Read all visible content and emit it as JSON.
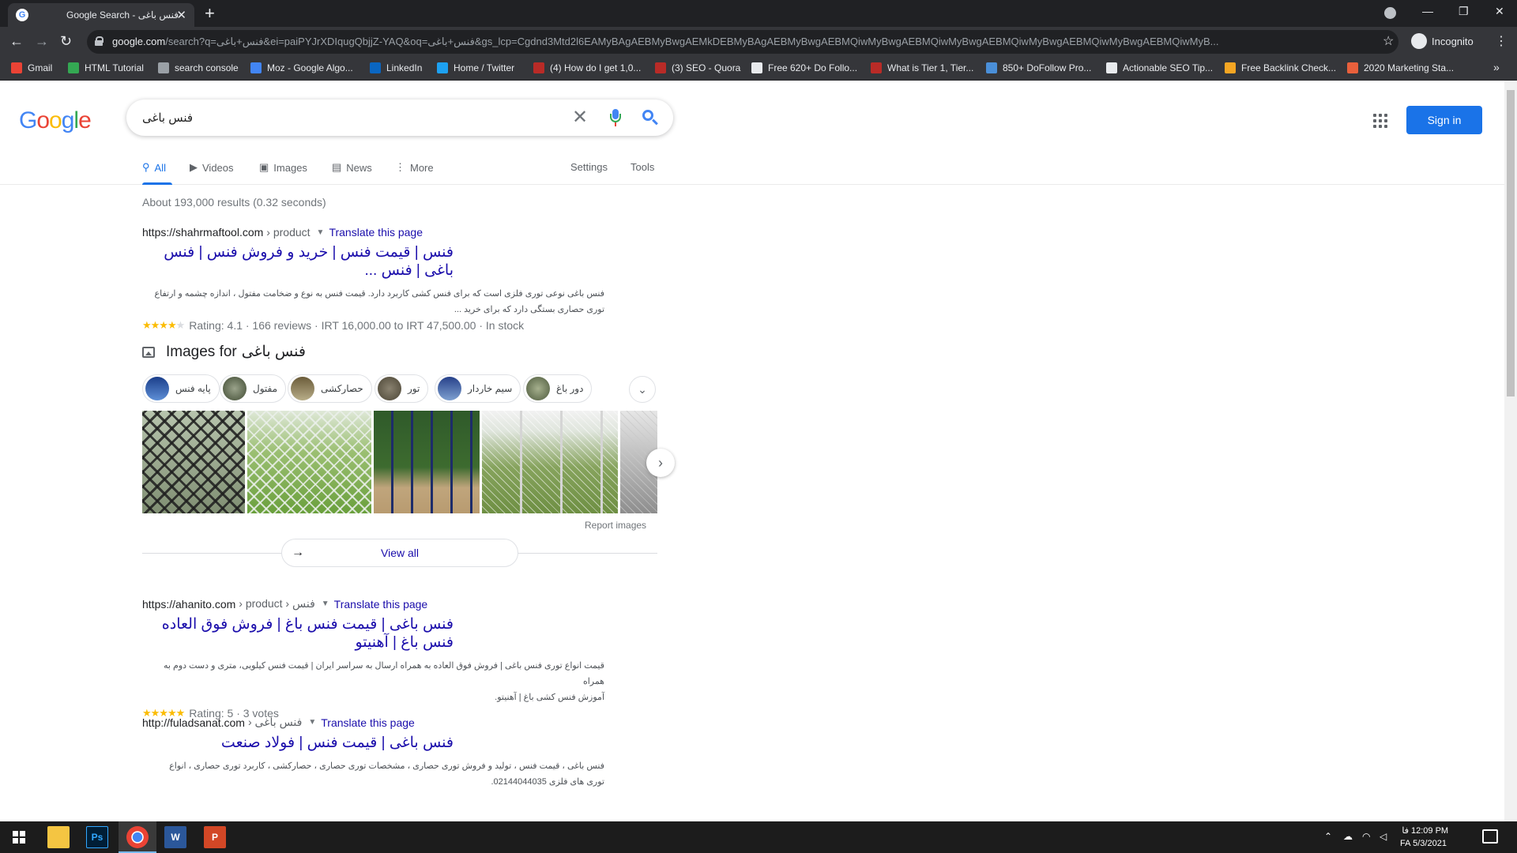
{
  "browser": {
    "tab_title": "Google Search - فنس باغی",
    "url_host": "google.com",
    "url_rest": "/search?q=فنس+باغی&ei=paiPYJrXDIqugQbjjZ-YAQ&oq=فنس+باغی&gs_lcp=Cgdnd3Mtd2l6EAMyBAgAEBMyBwgAEMkDEBMyBAgAEBMyBwgAEBMQiwMyBwgAEBMQiwMyBwgAEBMQiwMyBwgAEBMQiwMyBwgAEBMQiwMyB...",
    "incognito_label": "Incognito",
    "bookmarks": [
      {
        "label": "Gmail",
        "color": "#ea4335"
      },
      {
        "label": "HTML Tutorial",
        "color": "#34a853"
      },
      {
        "label": "search console",
        "color": "#9aa0a6"
      },
      {
        "label": "Moz - Google Algo...",
        "color": "#4285f4"
      },
      {
        "label": "LinkedIn",
        "color": "#0a66c2"
      },
      {
        "label": "Home / Twitter",
        "color": "#1da1f2"
      },
      {
        "label": "(4) How do I get 1,0...",
        "color": "#b92b27"
      },
      {
        "label": "(3) SEO - Quora",
        "color": "#b92b27"
      },
      {
        "label": "Free 620+ Do Follo...",
        "color": "#e8eaed"
      },
      {
        "label": "What is Tier 1, Tier...",
        "color": "#b92b27"
      },
      {
        "label": "850+ DoFollow Pro...",
        "color": "#4a8fd9"
      },
      {
        "label": "Actionable SEO Tip...",
        "color": "#e8eaed"
      },
      {
        "label": "Free Backlink Check...",
        "color": "#f5a623"
      },
      {
        "label": "2020 Marketing Sta...",
        "color": "#e8603c"
      }
    ]
  },
  "search": {
    "query": "فنس باغی",
    "signin_label": "Sign in",
    "tabs": [
      {
        "label": "All",
        "icon": "search-icon"
      },
      {
        "label": "Videos",
        "icon": "video-icon"
      },
      {
        "label": "Images",
        "icon": "image-icon"
      },
      {
        "label": "News",
        "icon": "news-icon"
      },
      {
        "label": "More",
        "icon": "more-icon"
      },
      {
        "label": "Settings",
        "icon": ""
      },
      {
        "label": "Tools",
        "icon": ""
      }
    ],
    "stats": "About 193,000 results (0.32 seconds)"
  },
  "results": [
    {
      "site": "https://shahrmaftool.com",
      "crumb": "› product",
      "translate": "Translate this page",
      "title": "فنس | قیمت فنس | خرید و فروش فنس | فنس باغی | فنس ...",
      "snippet_lines": [
        "فنس باغی نوعی توری فلزی است که برای فنس کشی کاربرد دارد. قیمت فنس به نوع و ضخامت مفتول ، اندازه چشمه و ارتفاع",
        "توری حصاری بستگی دارد که برای خرید ..."
      ],
      "rating_text": "Rating: 4.1 · 166 reviews · IRT 16,000.00 to IRT 47,500.00 · In stock",
      "stars": 4
    },
    {
      "site": "https://ahanito.com",
      "crumb": "› product › فنس",
      "translate": "Translate this page",
      "title": "فنس باغی | قیمت فنس باغ | فروش فوق العاده فنس باغ | آهنیتو",
      "snippet_lines": [
        "قیمت انواع توری فنس باغی | فروش فوق العاده به همراه ارسال به سراسر ایران | قیمت فنس کیلویی، متری و دست دوم به همراه",
        "آموزش فنس کشی باغ | آهنیتو."
      ],
      "rating_text": "Rating: 5 · 3 votes",
      "stars": 5
    },
    {
      "site": "http://fuladsanat.com",
      "crumb": "› فنس باغی",
      "translate": "Translate this page",
      "title": "فنس باغی | قیمت فنس | فولاد صنعت",
      "snippet_lines": [
        "فنس باغی ، قیمت فنس ، تولید و فروش توری حصاری ، مشخصات توری حصاری ، حصارکشی ، کاربرد توری حصاری ، انواع",
        "توری های فلزی 02144044035."
      ],
      "rating_text": "",
      "stars": 0
    }
  ],
  "images_block": {
    "heading": "Images for",
    "query": "فنس باغی",
    "chips": [
      "پایه فنس",
      "مفتول",
      "حصارکشی",
      "تور",
      "سیم خاردار",
      "دور باغ"
    ],
    "report_label": "Report images",
    "view_all_label": "View all"
  },
  "taskbar": {
    "time": "12:09 PM",
    "date": "5/3/2021",
    "lang_top": "فا",
    "lang_bottom": "FA"
  }
}
